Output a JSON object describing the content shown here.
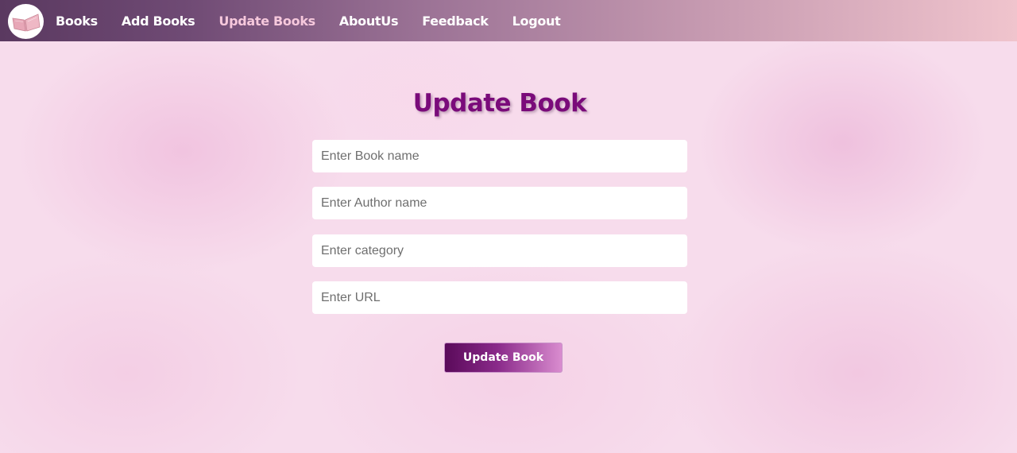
{
  "nav": {
    "logo_icon": "open-book-icon",
    "items": [
      {
        "label": "Books"
      },
      {
        "label": "Add Books"
      },
      {
        "label": "Update Books"
      },
      {
        "label": "AboutUs"
      },
      {
        "label": "Feedback"
      },
      {
        "label": "Logout"
      }
    ],
    "active_item": "Update Books"
  },
  "form": {
    "title": "Update Book",
    "book_name": {
      "placeholder": "Enter Book name",
      "value": ""
    },
    "author_name": {
      "placeholder": "Enter Author name",
      "value": ""
    },
    "category": {
      "placeholder": "Enter category",
      "value": ""
    },
    "url": {
      "placeholder": "Enter URL",
      "value": ""
    },
    "submit_label": "Update Book"
  },
  "colors": {
    "title": "#7a0b7a",
    "nav_gradient_start": "#5a3960",
    "nav_gradient_end": "#f0c4cd",
    "active_nav": "#f6c8dc",
    "button_gradient_start": "#5a0a5a",
    "button_gradient_end": "#d98ccf",
    "background": "#f7dcec"
  }
}
